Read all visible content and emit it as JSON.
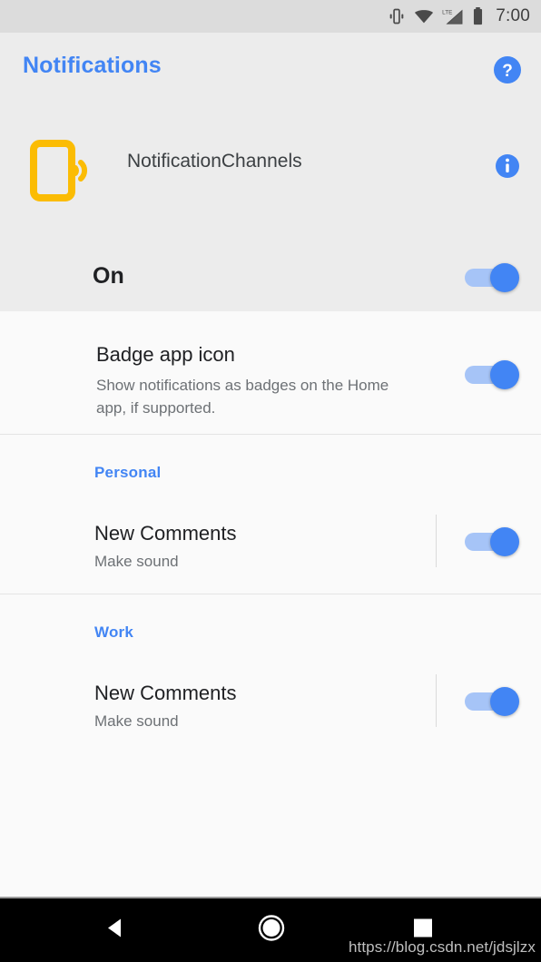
{
  "status_bar": {
    "icons": [
      "vibrate-icon",
      "wifi-icon",
      "lte-signal-icon",
      "battery-icon"
    ],
    "network_label": "LTE",
    "time": "7:00"
  },
  "header": {
    "title": "Notifications",
    "title_color": "#4285f4",
    "help_icon": "help-circle-icon",
    "help_glyph": "?"
  },
  "app": {
    "name": "NotificationChannels",
    "icon": "vibrating-phone-icon",
    "icon_color": "#fbbc04",
    "info_icon": "info-circle-icon",
    "info_glyph": "i"
  },
  "master_switch": {
    "label": "On",
    "state": "on"
  },
  "badge_setting": {
    "title": "Badge app icon",
    "description": "Show notifications as badges on the Home app, if supported.",
    "state": "on"
  },
  "groups": [
    {
      "name": "Personal",
      "channels": [
        {
          "title": "New Comments",
          "subtitle": "Make sound",
          "state": "on"
        }
      ]
    },
    {
      "name": "Work",
      "channels": [
        {
          "title": "New Comments",
          "subtitle": "Make sound",
          "state": "on"
        }
      ]
    }
  ],
  "nav_bar": {
    "back": "back-triangle-icon",
    "home": "home-circle-icon",
    "recent": "recents-square-icon",
    "watermark": "https://blog.csdn.net/jdsjlzx"
  },
  "colors": {
    "accent": "#4285f4",
    "track_on": "#a6c4f7",
    "header_bg": "#ececec",
    "content_bg": "#fafafa",
    "icon_amber": "#fbbc04"
  }
}
